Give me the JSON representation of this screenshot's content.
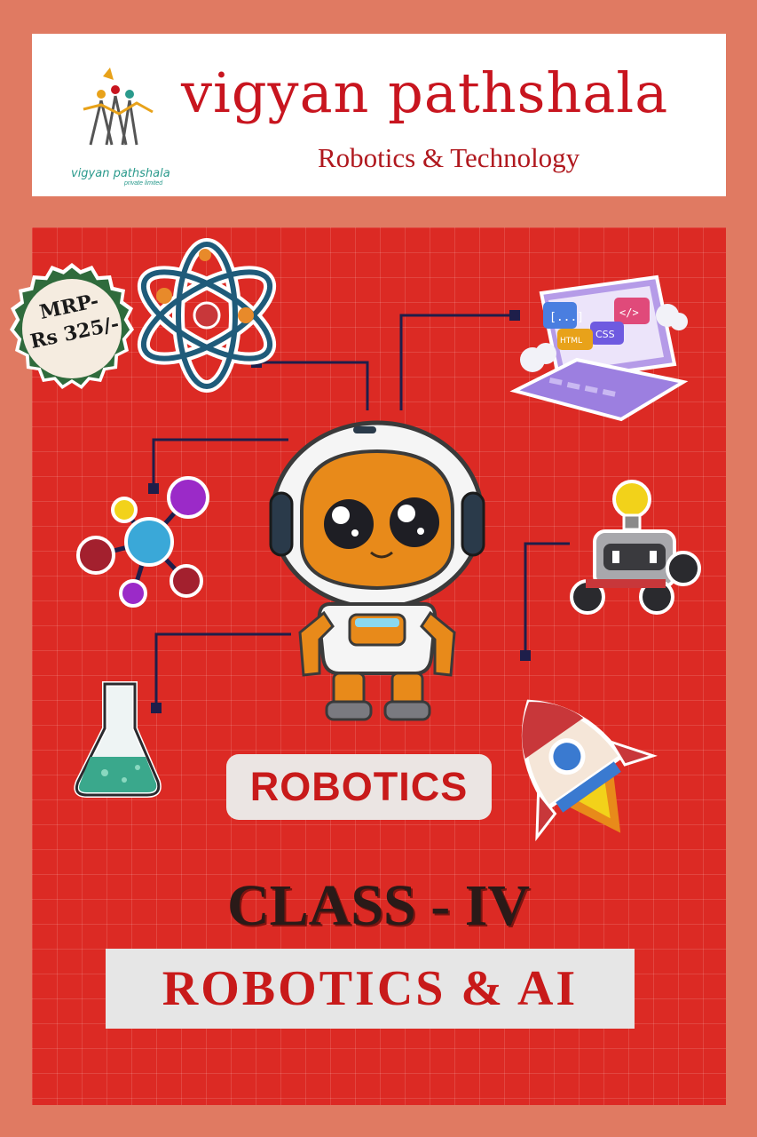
{
  "header": {
    "brand": "vigyan pathshala",
    "tagline": "Robotics & Technology",
    "logo_text": "vigyan pathshala",
    "logo_sub": "private limited"
  },
  "badge": {
    "line1": "MRP-",
    "line2": "Rs 325/-"
  },
  "subject_pill": "ROBOTICS",
  "class_title": "CLASS - IV",
  "book_title": "ROBOTICS & AI",
  "colors": {
    "background": "#e07a62",
    "board": "#dc2a24",
    "brand_red": "#c8151f",
    "badge_green": "#2f6b3c"
  },
  "icons": [
    "atom-icon",
    "laptop-code-icon",
    "molecule-icon",
    "robot-mascot",
    "robot-car-icon",
    "flask-icon",
    "rocket-icon"
  ]
}
